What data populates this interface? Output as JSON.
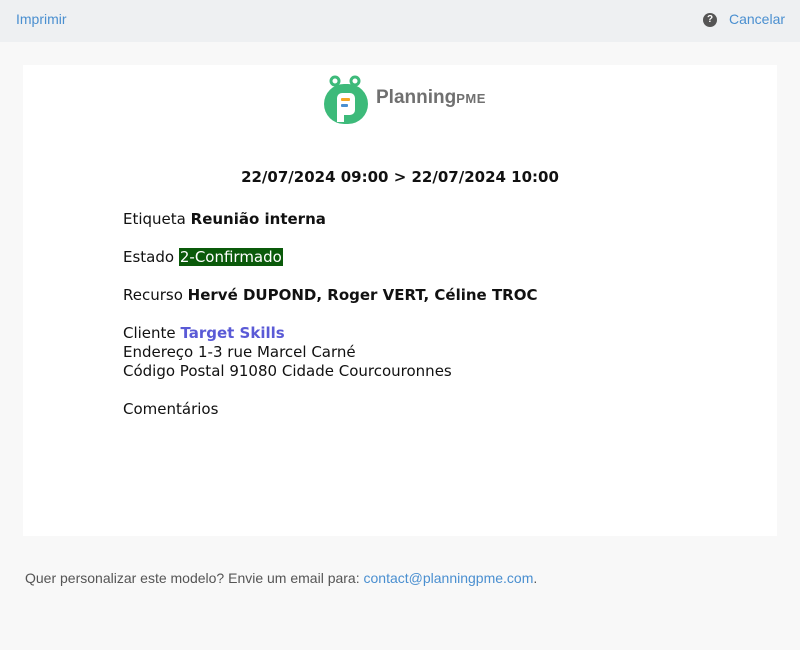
{
  "toolbar": {
    "print_label": "Imprimir",
    "help_icon": "question-circle-icon",
    "cancel_label": "Cancelar"
  },
  "logo": {
    "name_main": "Planning",
    "name_suffix": "PME"
  },
  "appointment": {
    "date_range": "22/07/2024 09:00 > 22/07/2024 10:00",
    "label_key": "Etiqueta",
    "label_value": "Reunião interna",
    "state_key": "Estado",
    "state_value": "2-Confirmado",
    "resource_key": "Recurso",
    "resource_value": "Hervé DUPOND, Roger VERT, Céline TROC",
    "client_key": "Cliente",
    "client_value": "Target Skills",
    "address_key": "Endereço",
    "address_value": "1-3 rue Marcel Carné",
    "postal_key": "Código Postal",
    "postal_value": "91080",
    "city_key": "Cidade",
    "city_value": "Courcouronnes",
    "comments_key": "Comentários"
  },
  "footer": {
    "text": "Quer personalizar este modelo? Envie um email para:",
    "email": "contact@planningpme.com",
    "trailing": "."
  },
  "colors": {
    "link": "#4a8fd0",
    "state_bg": "#0a5a0a",
    "client_link": "#5a5ad6",
    "logo_green": "#3dba7a"
  }
}
